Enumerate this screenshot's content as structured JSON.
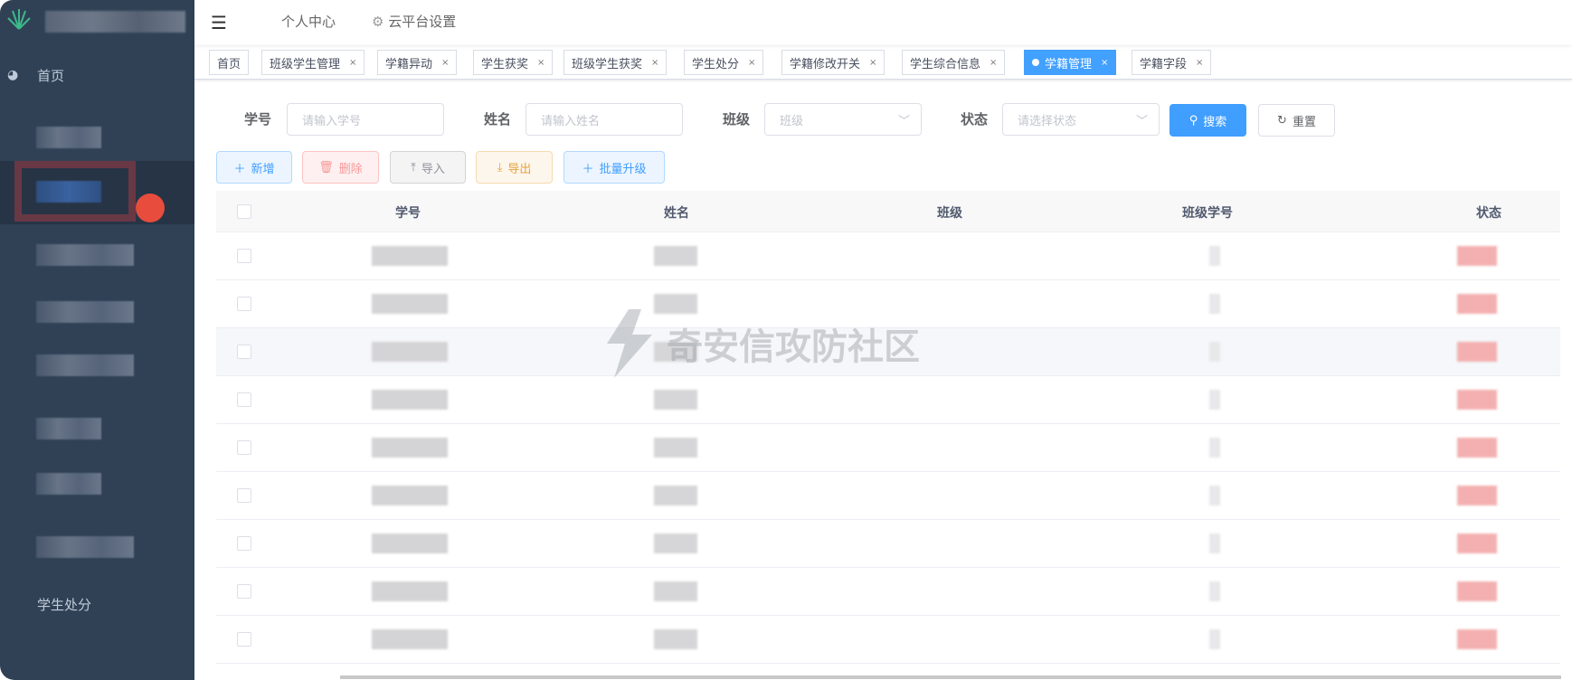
{
  "sidebar": {
    "home": "首页",
    "discipline": "学生处分",
    "redacted_items": 8
  },
  "topbar": {
    "personal_center": "个人中心",
    "cloud_settings": "云平台设置"
  },
  "tabs": [
    {
      "label": "首页",
      "closable": false,
      "active": false
    },
    {
      "label": "班级学生管理",
      "closable": true,
      "active": false
    },
    {
      "label": "学籍异动",
      "closable": true,
      "active": false
    },
    {
      "label": "学生获奖",
      "closable": true,
      "active": false
    },
    {
      "label": "班级学生获奖",
      "closable": true,
      "active": false
    },
    {
      "label": "学生处分",
      "closable": true,
      "active": false
    },
    {
      "label": "学籍修改开关",
      "closable": true,
      "active": false
    },
    {
      "label": "学生综合信息",
      "closable": true,
      "active": false
    },
    {
      "label": "学籍管理",
      "closable": true,
      "active": true
    },
    {
      "label": "学籍字段",
      "closable": true,
      "active": false
    }
  ],
  "close_glyph": "×",
  "filters": {
    "student_id": {
      "label": "学号",
      "placeholder": "请输入学号"
    },
    "name": {
      "label": "姓名",
      "placeholder": "请输入姓名"
    },
    "class": {
      "label": "班级",
      "placeholder": "班级"
    },
    "status": {
      "label": "状态",
      "placeholder": "请选择状态"
    },
    "search": "搜索",
    "reset": "重置"
  },
  "toolbar": {
    "add": "新增",
    "delete": "删除",
    "import": "导入",
    "export": "导出",
    "batch_upgrade": "批量升级"
  },
  "table": {
    "columns": [
      "学号",
      "姓名",
      "班级",
      "班级学号",
      "状态"
    ],
    "row_count": 9
  },
  "watermark": "奇安信攻防社区",
  "colors": {
    "primary": "#409eff",
    "sidebar": "#304156",
    "danger": "#f56c6c",
    "warning": "#e6a23c"
  }
}
